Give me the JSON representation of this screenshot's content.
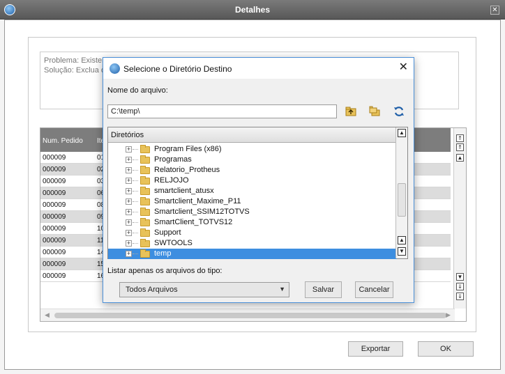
{
  "window": {
    "title": "Detalhes",
    "close_glyph": "✕"
  },
  "problem": {
    "line1": "Problema: Existem",
    "line2": "Solução: Exclua o"
  },
  "grid": {
    "headers": [
      "Num. Pedido",
      "Ite"
    ],
    "rows": [
      [
        "000009",
        "01"
      ],
      [
        "000009",
        "02"
      ],
      [
        "000009",
        "03"
      ],
      [
        "000009",
        "06"
      ],
      [
        "000009",
        "08"
      ],
      [
        "000009",
        "09"
      ],
      [
        "000009",
        "10"
      ],
      [
        "000009",
        "11"
      ],
      [
        "000009",
        "14"
      ],
      [
        "000009",
        "15"
      ],
      [
        "000009",
        "16"
      ]
    ]
  },
  "buttons": {
    "export": "Exportar",
    "ok": "OK"
  },
  "dialog": {
    "title": "Selecione o Diretório Destino",
    "close_glyph": "✕",
    "file_name_label": "Nome do arquivo:",
    "path_value": "C:\\temp\\",
    "tree_header": "Diretórios",
    "folders": [
      "Program Files (x86)",
      "Programas",
      "Relatorio_Protheus",
      "RELJOJO",
      "smartclient_atusx",
      "Smartclient_Maxime_P11",
      "Smartclient_SSIM12TOTVS",
      "SmartClient_TOTVS12",
      "Support",
      "SWTOOLS",
      "temp"
    ],
    "selected_folder": "temp",
    "filter_label": "Listar apenas os arquivos do tipo:",
    "filter_value": "Todos Arquivos",
    "save_label": "Salvar",
    "cancel_label": "Cancelar"
  },
  "icons": [
    "app-logo-icon",
    "folder-up-icon",
    "new-folder-icon",
    "refresh-icon",
    "folder-icon",
    "expand-icon",
    "chevron-down-icon"
  ],
  "colors": {
    "title_bar": "#6a6a6a",
    "grid_header": "#7d7d7d",
    "selection": "#3d8ee0",
    "dialog_border": "#4a8fd8",
    "refresh": "#1f5fa8"
  }
}
